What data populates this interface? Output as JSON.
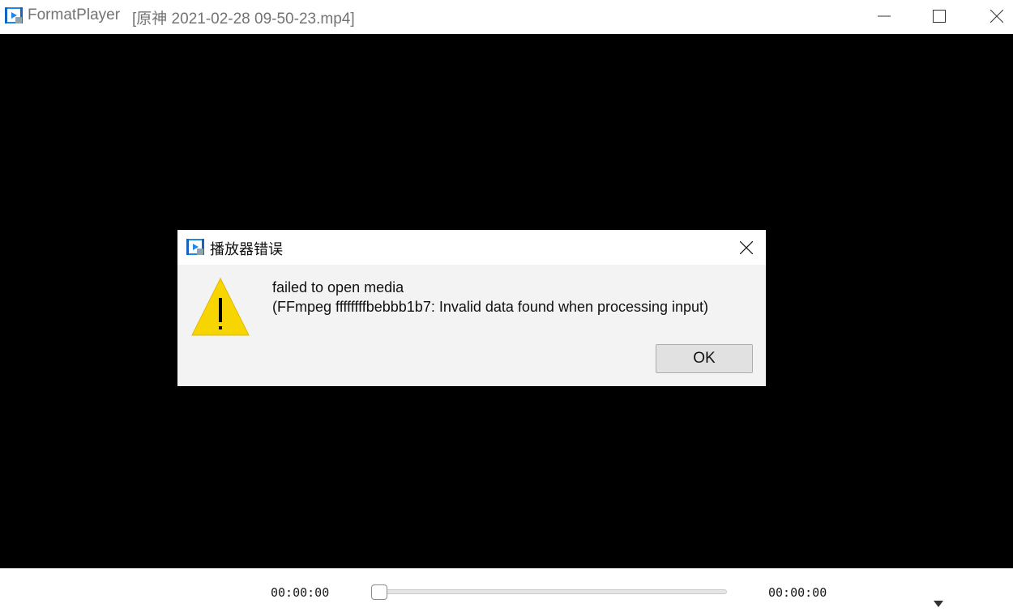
{
  "window": {
    "app_name": "FormatPlayer",
    "file_title": "[原神 2021-02-28 09-50-23.mp4]",
    "icon": "app-video-icon",
    "controls": [
      "minimize-icon",
      "maximize-icon",
      "close-icon"
    ]
  },
  "player": {
    "current_time": "00:00:00",
    "total_time": "00:00:00",
    "progress": 0
  },
  "dialog": {
    "title": "播放器错误",
    "message_line1": "failed to open media",
    "message_line2": "(FFmpeg ffffffffbebbb1b7: Invalid data found when processing input)",
    "ok_label": "OK",
    "icon": "warning-icon"
  },
  "colors": {
    "video_background": "#000000",
    "warning_yellow": "#f7d500",
    "icon_blue": "#1e88e5"
  }
}
